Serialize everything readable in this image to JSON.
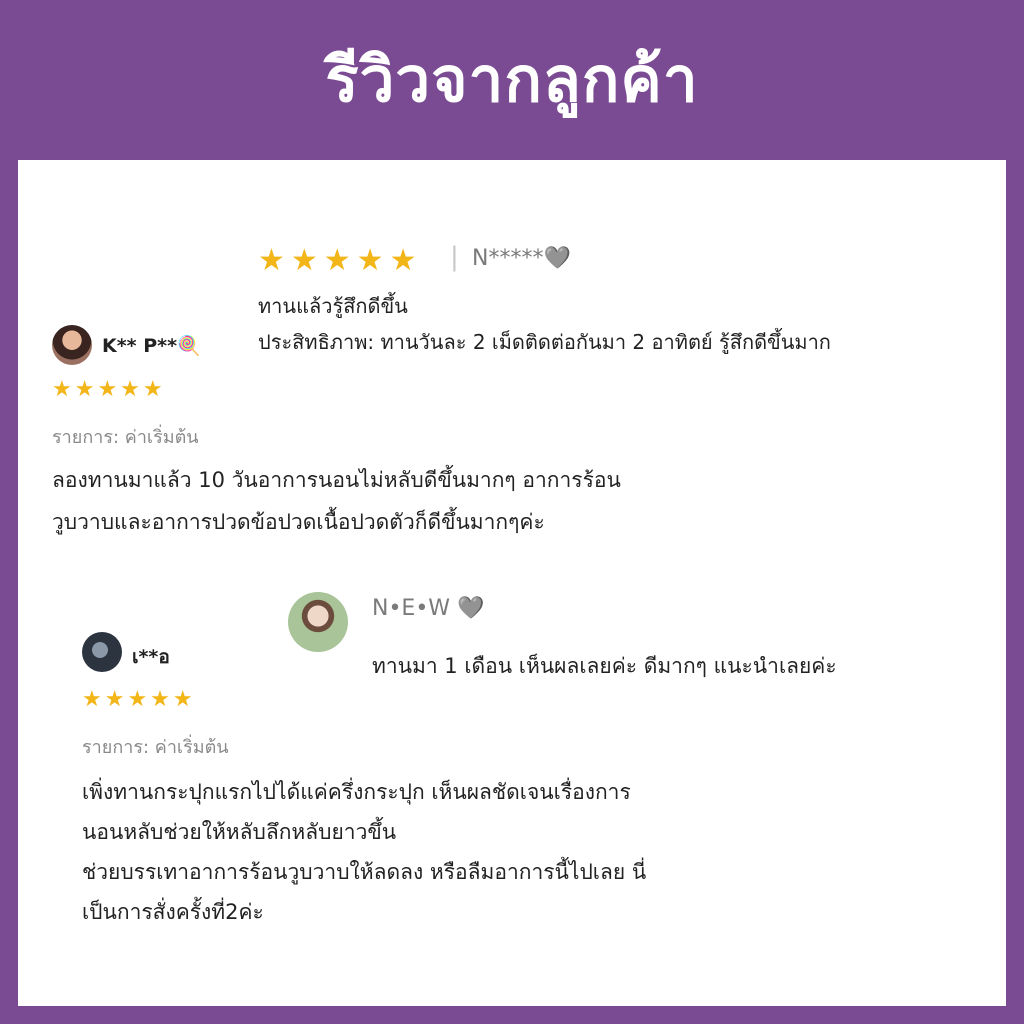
{
  "header": {
    "title": "รีวิวจากลูกค้า"
  },
  "colors": {
    "header_bg": "#7a4b93",
    "star": "#f2b619",
    "panel_bg": "#ffffff"
  },
  "review_top_right": {
    "rating": 5,
    "stars": "★★★★★",
    "separator": "|",
    "username": "N*****",
    "user_icon": "gray-heart-icon",
    "heart": "🩶",
    "line1": "ทานแล้วรู้สึกดีขึ้น",
    "line2": "ประสิทธิภาพ: ทานวันละ 2 เม็ดติดต่อกันมา 2 อาทิตย์ รู้สึกดีขึ้นมาก"
  },
  "review_left_1": {
    "username": "K** P**",
    "user_icon": "lollipop-icon",
    "emoji": "🍭",
    "rating": 5,
    "stars": "★★★★★",
    "item_label": "รายการ: ค่าเริ่มต้น",
    "text_line1": "ลองทานมาแล้ว 10 วันอาการนอนไม่หลับดีขึ้นมากๆ อาการร้อน",
    "text_line2": "วูบวาบและอาการปวดข้อปวดเนื้อปวดตัวก็ดีขึ้นมากๆค่ะ"
  },
  "review_right_2": {
    "username": "N•E•W",
    "user_icon": "gray-heart-icon",
    "heart": "🩶",
    "text": "ทานมา 1 เดือน เห็นผลเลยค่ะ ดีมากๆ แนะนำเลยค่ะ"
  },
  "review_left_2": {
    "username": "เ**อ",
    "rating": 5,
    "stars": "★★★★★",
    "item_label": "รายการ: ค่าเริ่มต้น",
    "text_line1": "เพิ่งทานกระปุกแรกไปได้แค่ครึ่งกระปุก เห็นผลชัดเจนเรื่องการ",
    "text_line2": "นอนหลับช่วยให้หลับลึกหลับยาวขึ้น",
    "text_line3": "ช่วยบรรเทาอาการร้อนวูบวาบให้ลดลง  หรือลืมอาการนี้ไปเลย นี่",
    "text_line4": "เป็นการสั่งครั้งที่2ค่ะ"
  }
}
